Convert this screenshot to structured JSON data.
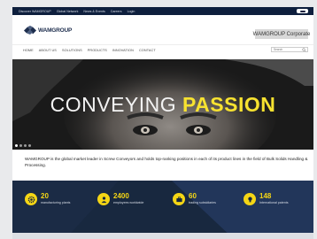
{
  "topbar": {
    "links": [
      "Discover WAMGROUP",
      "Global Network",
      "News & Events",
      "Careers",
      "Login"
    ]
  },
  "header": {
    "logo_text": "WAMGROUP",
    "corporate_button": "WAMGROUP Corporate"
  },
  "nav": {
    "items": [
      "HOME",
      "ABOUT US",
      "SOLUTIONS",
      "PRODUCTS",
      "INNOVATION",
      "CONTACT"
    ],
    "search_placeholder": "Search"
  },
  "hero": {
    "title_light": "CONVEYING",
    "title_bold": "PASSION",
    "slides": 4,
    "active_slide": 1
  },
  "intro": {
    "text": "WAMGROUP is the global market leader in Screw Conveyors and holds top-ranking positions in each of its product lines in the field of Bulk Solids Handling & Processing."
  },
  "stats": [
    {
      "value": "20",
      "label": "manufacturing plants",
      "icon": "gear-icon"
    },
    {
      "value": "2400",
      "label": "employees worldwide",
      "icon": "person-icon"
    },
    {
      "value": "60",
      "label": "trading subsidiaries",
      "icon": "briefcase-icon"
    },
    {
      "value": "148",
      "label": "International patents",
      "icon": "lightbulb-icon"
    }
  ],
  "colors": {
    "navy": "#0e1f3d",
    "accent_yellow": "#f5d615",
    "stats_band": "#1f3150"
  }
}
